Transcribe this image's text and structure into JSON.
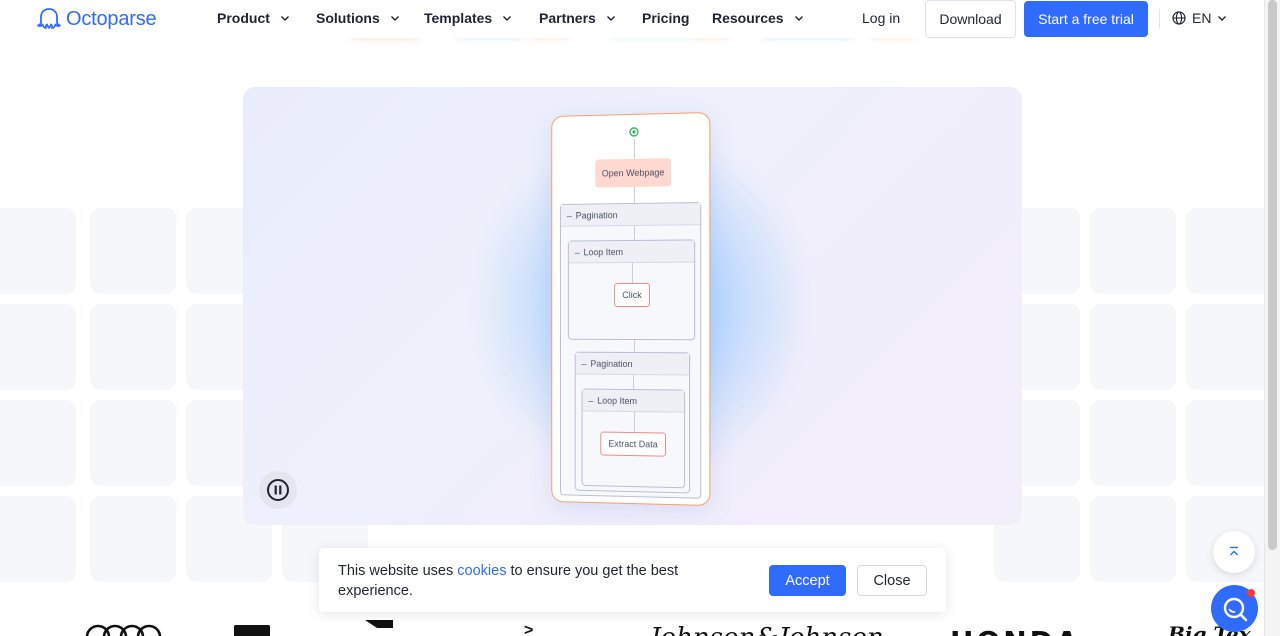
{
  "brand": {
    "name": "Octoparse",
    "accent": "#2f6bff"
  },
  "nav": {
    "items": [
      {
        "label": "Product",
        "has_dropdown": true
      },
      {
        "label": "Solutions",
        "has_dropdown": true
      },
      {
        "label": "Templates",
        "has_dropdown": true
      },
      {
        "label": "Partners",
        "has_dropdown": true
      },
      {
        "label": "Pricing",
        "has_dropdown": false
      },
      {
        "label": "Resources",
        "has_dropdown": true
      }
    ],
    "login_label": "Log in",
    "download_label": "Download",
    "trial_label": "Start a free trial",
    "language": "EN"
  },
  "hero": {
    "workflow": {
      "open_webpage": "Open Webpage",
      "pagination_1": "Pagination",
      "loop_item_1": "Loop Item",
      "click": "Click",
      "pagination_2": "Pagination",
      "loop_item_2": "Loop Item",
      "extract_data": "Extract Data"
    },
    "pause_icon": "pause-icon"
  },
  "cookie_banner": {
    "text_before": "This website uses ",
    "link_text": "cookies",
    "text_after": " to ensure you get the best experience.",
    "accept_label": "Accept",
    "close_label": "Close"
  },
  "floating": {
    "scroll_top_icon": "chevron-up-double-icon",
    "chat_icon": "chat-search-icon"
  },
  "client_logos": [
    "Audi",
    "Johnson&Johnson",
    "HONDA",
    "Big Tex"
  ]
}
